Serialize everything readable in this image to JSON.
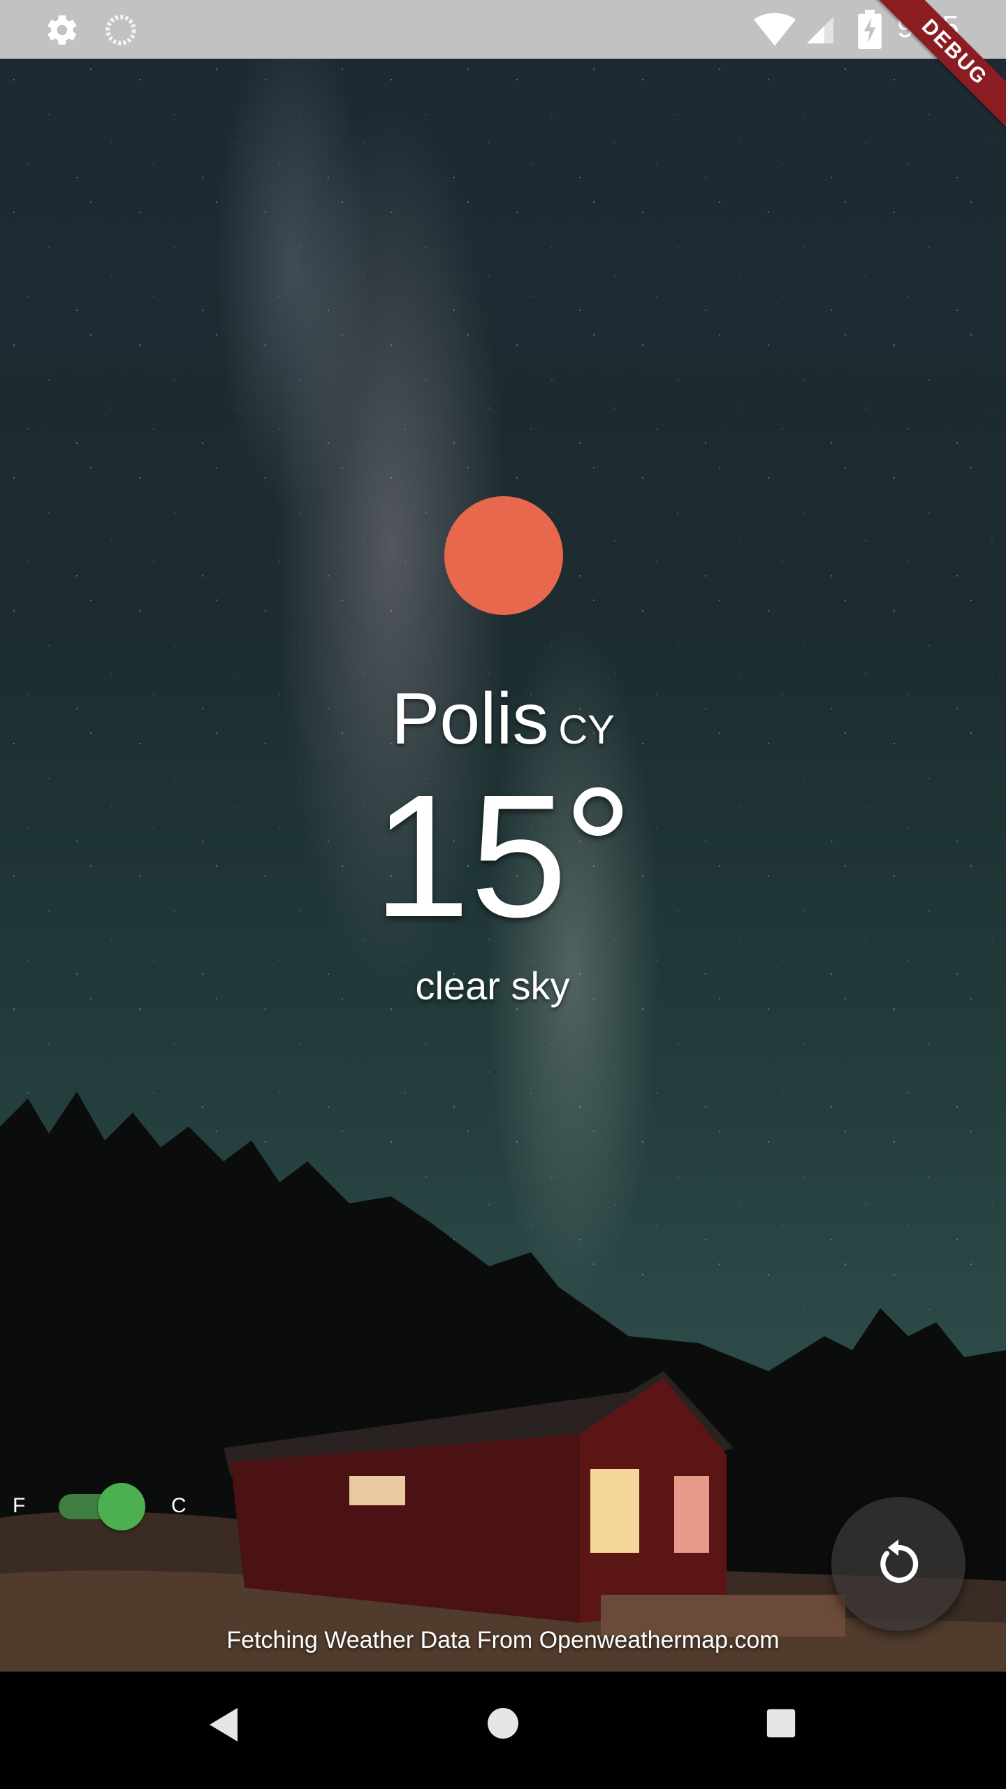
{
  "status_bar": {
    "time": "9:15",
    "icons": [
      "gear-icon",
      "loading-circle-icon",
      "wifi-icon",
      "cell-signal-icon",
      "battery-charging-icon"
    ]
  },
  "debug_banner": "DEBUG",
  "weather": {
    "icon": "sun-icon",
    "icon_color": "#e8684d",
    "city": "Polis",
    "country": "CY",
    "temperature": "15",
    "degree_symbol": "°",
    "description": "clear sky"
  },
  "unit_toggle": {
    "left_label": "F",
    "right_label": "C",
    "selected": "C",
    "accent_color": "#4caf50"
  },
  "refresh_button": {
    "icon": "refresh-icon"
  },
  "footer": {
    "text": "Fetching Weather Data From Openweathermap.com"
  },
  "nav_bar": {
    "icons": [
      "back-icon",
      "home-icon",
      "recent-apps-icon"
    ]
  }
}
